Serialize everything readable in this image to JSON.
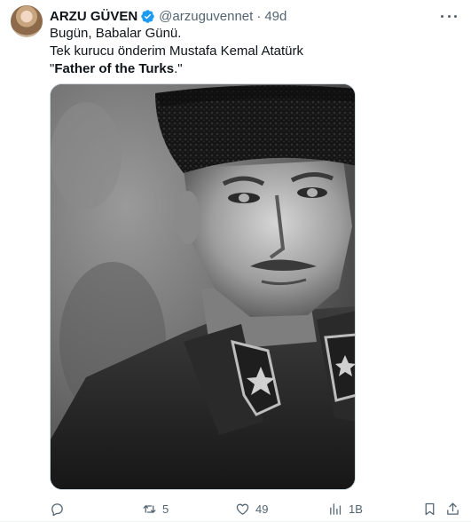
{
  "tweet": {
    "author_name": "ARZU GÜVEN",
    "handle": "@arzuguvennet",
    "separator": "·",
    "time": "49d",
    "lines": [
      "Bugün, Babalar Günü.",
      "Tek kurucu önderim Mustafa Kemal Atatürk"
    ],
    "quote_open": "\"",
    "quote_bold": "Father of the Turks",
    "quote_close": ".\"",
    "image_alt": "Black and white portrait of Mustafa Kemal Atatürk in a fur kalpak hat and military uniform",
    "stats": {
      "replies": "",
      "reposts": "5",
      "likes": "49",
      "views": "1B"
    }
  },
  "icons": {
    "verified": "verified-badge-icon",
    "more": "more-dots-icon",
    "reply": "reply-icon",
    "repost": "repost-icon",
    "like": "like-icon",
    "views": "views-icon",
    "bookmark": "bookmark-icon",
    "share": "share-icon"
  },
  "colors": {
    "text": "#0f1419",
    "secondary": "#536471",
    "verified": "#1d9bf0"
  }
}
